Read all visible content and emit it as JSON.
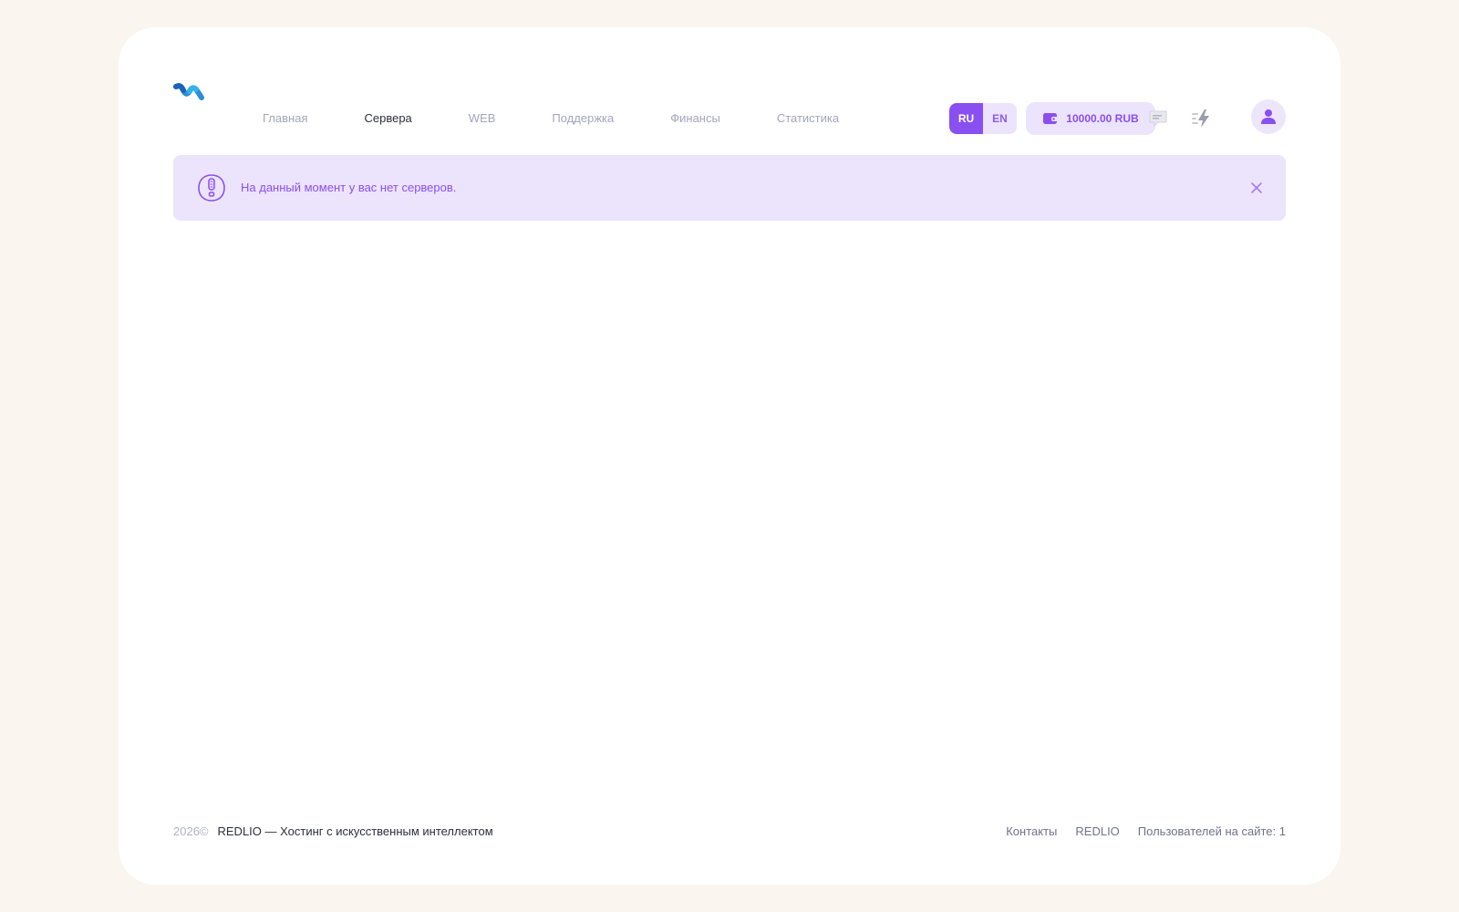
{
  "header": {
    "nav": [
      {
        "label": "Главная",
        "active": false
      },
      {
        "label": "Сервера",
        "active": true
      },
      {
        "label": "WEB",
        "active": false
      },
      {
        "label": "Поддержка",
        "active": false
      },
      {
        "label": "Финансы",
        "active": false
      },
      {
        "label": "Статистика",
        "active": false
      }
    ],
    "lang": {
      "ru": "RU",
      "en": "EN",
      "selected": "RU"
    },
    "balance": "10000.00 RUB",
    "icons": [
      "logo-icon",
      "wallet-icon",
      "chat-icon",
      "lightning-icon",
      "user-icon"
    ]
  },
  "alert": {
    "message": "На данный момент у вас нет серверов.",
    "icons": [
      "exclamation-icon",
      "close-icon"
    ]
  },
  "footer": {
    "year": "2026©",
    "brand": "REDLIO — Хостинг с искусственным интеллектом",
    "contacts": "Контакты",
    "site": "REDLIO",
    "online": "Пользователей на сайте: 1"
  },
  "colors": {
    "background": "#faf5ee",
    "accent": "#8a4ff0",
    "accent_light": "#ece4fc",
    "text_dark": "#2d2f3d",
    "text_muted": "#a3a5bd"
  }
}
